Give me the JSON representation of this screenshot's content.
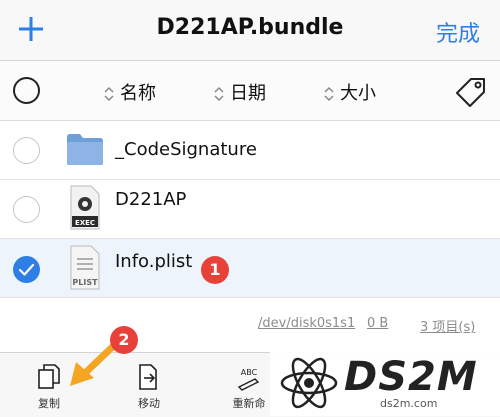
{
  "nav": {
    "title": "D221AP.bundle",
    "done": "完成"
  },
  "sort": {
    "name": "名称",
    "date": "日期",
    "size": "大小"
  },
  "files": [
    {
      "name": "_CodeSignature",
      "type": "folder",
      "selected": false
    },
    {
      "name": "D221AP",
      "type": "exec",
      "icon_text": "EXEC",
      "selected": false
    },
    {
      "name": "Info.plist",
      "type": "plist",
      "icon_text": "PLIST",
      "selected": true
    }
  ],
  "step_badges": {
    "one": "1",
    "two": "2"
  },
  "footer": {
    "path": "/dev/disk0s1s1",
    "size": "0 B",
    "items": "3 项目(s)"
  },
  "toolbar": {
    "copy": "复制",
    "move": "移动",
    "rename": "重新命",
    "rename_icon_text": "ABC"
  },
  "watermark": {
    "logo": "DS2M",
    "url": "ds2m.com"
  },
  "colors": {
    "accent": "#2f7ee6",
    "badge": "#e8413a",
    "arrow": "#f4a623"
  }
}
